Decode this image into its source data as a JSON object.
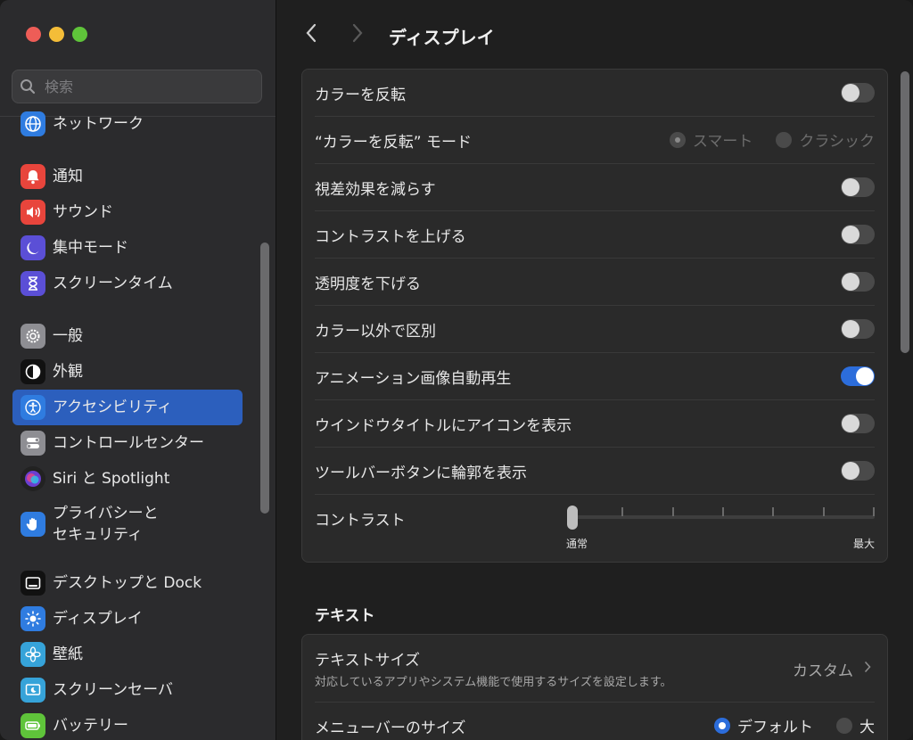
{
  "search": {
    "placeholder": "検索"
  },
  "sidebar": {
    "items": [
      {
        "label": "ネットワーク",
        "icon": "globe-icon",
        "color": "#2f7ce0"
      },
      {
        "label": "通知",
        "icon": "bell-icon",
        "color": "#e8453c"
      },
      {
        "label": "サウンド",
        "icon": "speaker-icon",
        "color": "#e8453c"
      },
      {
        "label": "集中モード",
        "icon": "moon-icon",
        "color": "#5b4fd6"
      },
      {
        "label": "スクリーンタイム",
        "icon": "hourglass-icon",
        "color": "#5b4fd6"
      },
      {
        "label": "一般",
        "icon": "gear-icon",
        "color": "#8e8e93"
      },
      {
        "label": "外観",
        "icon": "appearance-icon",
        "color": "#111111"
      },
      {
        "label": "アクセシビリティ",
        "icon": "accessibility-icon",
        "color": "#2f7ce0"
      },
      {
        "label": "コントロールセンター",
        "icon": "switches-icon",
        "color": "#8e8e93"
      },
      {
        "label": "Siri と Spotlight",
        "icon": "siri-icon",
        "color": "#222222"
      },
      {
        "label": "プライバシーと",
        "label2": "セキュリティ",
        "icon": "hand-icon",
        "color": "#2f7ce0"
      },
      {
        "label": "デスクトップと Dock",
        "icon": "dock-icon",
        "color": "#111111"
      },
      {
        "label": "ディスプレイ",
        "icon": "sun-icon",
        "color": "#2f7ce0"
      },
      {
        "label": "壁紙",
        "icon": "flower-icon",
        "color": "#36a3d9"
      },
      {
        "label": "スクリーンセーバ",
        "icon": "screensaver-icon",
        "color": "#36a3d9"
      },
      {
        "label": "バッテリー",
        "icon": "battery-icon",
        "color": "#5fc43a"
      }
    ]
  },
  "header": {
    "title": "ディスプレイ"
  },
  "display": {
    "invert_colors": {
      "label": "カラーを反転",
      "on": false
    },
    "invert_mode": {
      "label": "“カラーを反転” モード",
      "options": [
        "スマート",
        "クラシック"
      ],
      "selected": "スマート"
    },
    "reduce_motion": {
      "label": "視差効果を減らす",
      "on": false
    },
    "increase_contrast": {
      "label": "コントラストを上げる",
      "on": false
    },
    "reduce_transparency": {
      "label": "透明度を下げる",
      "on": false
    },
    "differentiate_without_color": {
      "label": "カラー以外で区別",
      "on": false
    },
    "autoplay_animated_images": {
      "label": "アニメーション画像自動再生",
      "on": true
    },
    "window_title_icons": {
      "label": "ウインドウタイトルにアイコンを表示",
      "on": false
    },
    "toolbar_button_shapes": {
      "label": "ツールバーボタンに輪郭を表示",
      "on": false
    },
    "contrast": {
      "label": "コントラスト",
      "min_label": "通常",
      "max_label": "最大",
      "value": 0,
      "ticks": 7
    }
  },
  "text_section": {
    "title": "テキスト",
    "text_size": {
      "label": "テキストサイズ",
      "description": "対応しているアプリやシステム機能で使用するサイズを設定します。",
      "value": "カスタム"
    },
    "menubar_size": {
      "label": "メニューバーのサイズ",
      "options": [
        "デフォルト",
        "大"
      ],
      "selected": "デフォルト"
    }
  },
  "colors": {
    "accent": "#2c6ddb",
    "sidebar_selected": "#2c5fbd"
  }
}
